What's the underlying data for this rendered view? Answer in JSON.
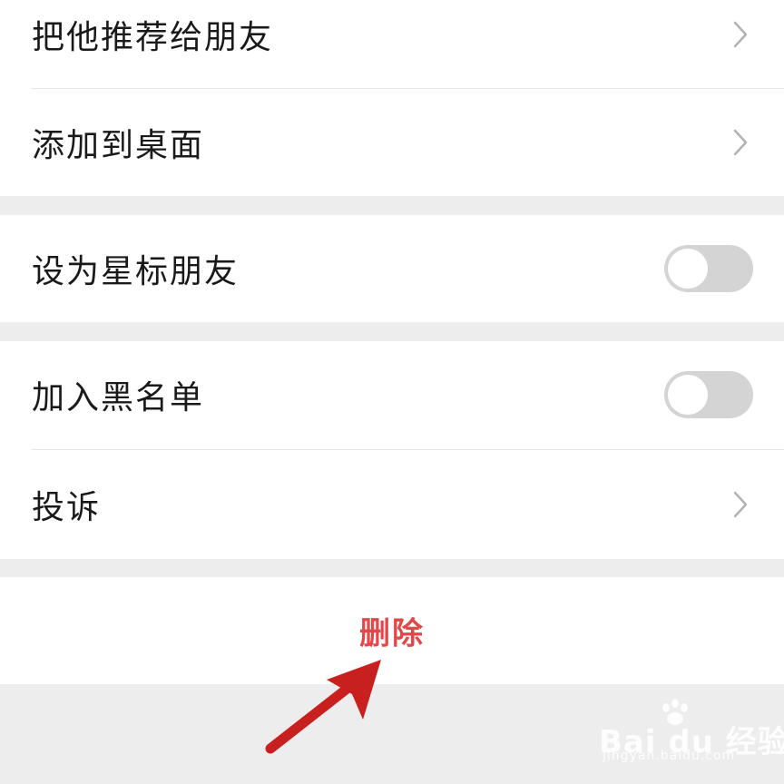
{
  "rows": {
    "recommend": {
      "label": "把他推荐给朋友",
      "icon": "chevron-right-icon"
    },
    "add_desktop": {
      "label": "添加到桌面",
      "icon": "chevron-right-icon"
    },
    "star_friend": {
      "label": "设为星标朋友",
      "toggle_on": false
    },
    "blacklist": {
      "label": "加入黑名单",
      "toggle_on": false
    },
    "complain": {
      "label": "投诉",
      "icon": "chevron-right-icon"
    }
  },
  "delete_button": {
    "label": "删除",
    "color": "#e4474a"
  },
  "annotation": {
    "icon": "red-arrow-icon",
    "color": "#c8201e"
  },
  "watermark": {
    "brand": "Bai du 经验",
    "url": "jingyan.baidu.com"
  },
  "colors": {
    "background": "#ededed",
    "toggle_off": "#d4d4d4",
    "chevron": "#b2b2b2"
  }
}
